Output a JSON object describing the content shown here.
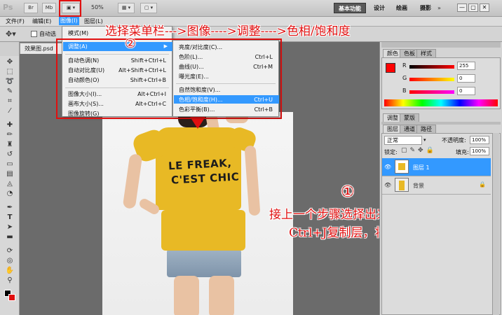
{
  "appbar": {
    "logo": "Ps",
    "br": "Br",
    "mb": "Mb",
    "zoom": "50%",
    "workspace_basic": "基本功能",
    "workspace_design": "设计",
    "workspace_paint": "绘画",
    "workspace_photo": "摄影",
    "minimize": "—",
    "restore": "▢",
    "close": "✕"
  },
  "menubar": {
    "items": [
      "文件(F)",
      "编辑(E)",
      "图像(I)",
      "图层(L)"
    ]
  },
  "optbar": {
    "auto_select": "自动选"
  },
  "document": {
    "tab_label": "效果图.psd"
  },
  "shirt_text": {
    "line1": "LE FREAK,",
    "line2": "C'EST CHIC"
  },
  "image_menu": {
    "items": [
      {
        "label": "模式(M)",
        "shortcut": ""
      },
      {
        "label": "调整(A)",
        "shortcut": ""
      },
      {
        "label": "自动色调(N)",
        "shortcut": "Shift+Ctrl+L"
      },
      {
        "label": "自动对比度(U)",
        "shortcut": "Alt+Shift+Ctrl+L"
      },
      {
        "label": "自动颜色(O)",
        "shortcut": "Shift+Ctrl+B"
      },
      {
        "label": "图像大小(I)...",
        "shortcut": "Alt+Ctrl+I"
      },
      {
        "label": "画布大小(S)...",
        "shortcut": "Alt+Ctrl+C"
      },
      {
        "label": "图像旋转(G)",
        "shortcut": ""
      }
    ]
  },
  "adjust_submenu": {
    "items": [
      {
        "label": "亮度/对比度(C)...",
        "shortcut": ""
      },
      {
        "label": "色阶(L)...",
        "shortcut": "Ctrl+L"
      },
      {
        "label": "曲线(U)...",
        "shortcut": "Ctrl+M"
      },
      {
        "label": "曝光度(E)...",
        "shortcut": ""
      },
      {
        "label": "自然饱和度(V)...",
        "shortcut": ""
      },
      {
        "label": "色相/饱和度(H)...",
        "shortcut": "Ctrl+U"
      },
      {
        "label": "色彩平衡(B)...",
        "shortcut": "Ctrl+B"
      }
    ]
  },
  "annotations": {
    "step2_marker": "②",
    "step2_text": "选择菜单栏--->图像---->调整---->色相/饱和度",
    "step1_marker": "①",
    "step1_line1": "接上一个步骤选择出来的选区范围",
    "step1_line2": "Ctrl+J复制层，将T恤独立出来"
  },
  "color_panel": {
    "tabs": [
      "颜色",
      "色板",
      "样式"
    ],
    "r_label": "R",
    "r_value": "255",
    "g_label": "G",
    "g_value": "0",
    "b_label": "B",
    "b_value": "0"
  },
  "adjust_panel": {
    "tabs": [
      "调整",
      "蒙版"
    ]
  },
  "layers_panel": {
    "tabs": [
      "图层",
      "通道",
      "路径"
    ],
    "blend_mode": "正常",
    "opacity_label": "不透明度:",
    "opacity_value": "100%",
    "lock_label": "锁定:",
    "fill_label": "填充:",
    "fill_value": "100%",
    "layers": [
      {
        "name": "图层 1"
      },
      {
        "name": "背景"
      }
    ]
  },
  "colors": {
    "accent_red": "#e01010",
    "highlight_blue": "#3399ff",
    "foreground": "#ff0000"
  }
}
